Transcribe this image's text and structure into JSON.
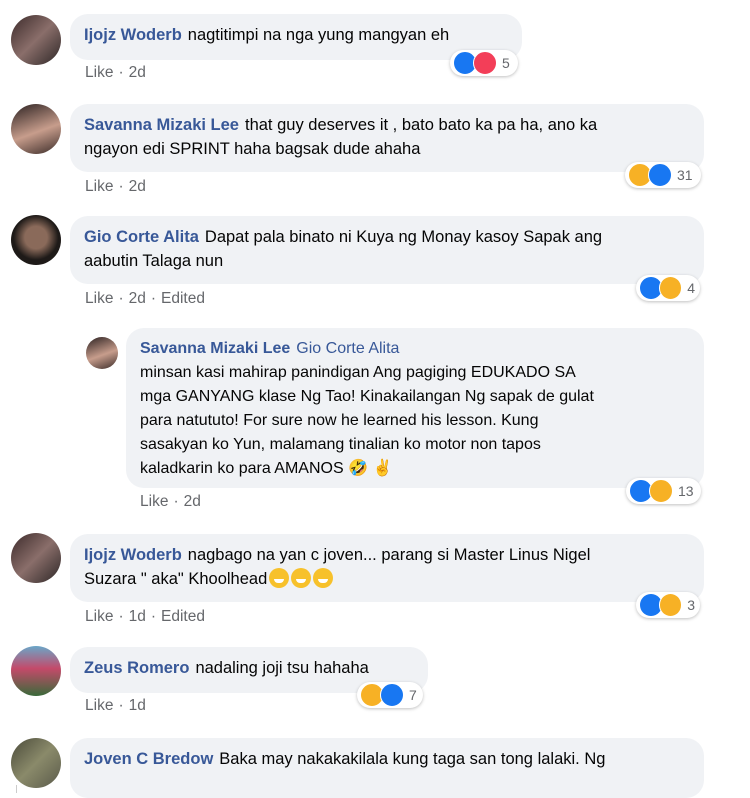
{
  "comments": [
    {
      "author": "Ijojz Woderb",
      "text": "nagtitimpi na nga yung mangyan eh",
      "like_label": "Like",
      "age": "2d",
      "edited": "",
      "reaction_count": "5"
    },
    {
      "author": "Savanna Mizaki Lee",
      "text_line1": "that guy deserves it , bato bato ka pa ha, ano ka",
      "text_line2": "ngayon edi SPRINT haha bagsak dude ahaha",
      "like_label": "Like",
      "age": "2d",
      "reaction_count": "31"
    },
    {
      "author": "Gio Corte Alita",
      "text_line1": "Dapat pala binato ni Kuya ng Monay kasoy Sapak ang",
      "text_line2": "aabutin Talaga nun",
      "like_label": "Like",
      "age": "2d",
      "edited": "Edited",
      "reaction_count": "4"
    },
    {
      "author": "Savanna Mizaki Lee",
      "tagged": "Gio Corte Alita",
      "lines": [
        "minsan kasi mahirap panindigan Ang pagiging EDUKADO SA",
        "mga GANYANG klase Ng Tao! Kinakailangan Ng sapak de gulat",
        "para natututo! For sure now he learned his lesson. Kung",
        "sasakyan ko Yun, malamang tinalian ko motor non tapos",
        "kaladkarin ko para AMANOS"
      ],
      "emoji_trail": "🤣 ✌",
      "like_label": "Like",
      "age": "2d",
      "reaction_count": "13"
    },
    {
      "author": "Ijojz Woderb",
      "text_line1": "nagbago na yan c joven... parang si Master Linus Nigel",
      "text_line2": "Suzara \" aka\" Khoolhead",
      "like_label": "Like",
      "age": "1d",
      "edited": "Edited",
      "reaction_count": "3"
    },
    {
      "author": "Zeus Romero",
      "text": "nadaling joji tsu hahaha",
      "like_label": "Like",
      "age": "1d",
      "reaction_count": "7"
    },
    {
      "author": "Joven C Bredow",
      "text": "Baka may nakakakilala kung taga san tong lalaki. Ng"
    }
  ],
  "colors": {
    "author": "#385898",
    "bubble": "#f0f2f5",
    "meta": "#65676b",
    "like_reaction": "#1877f2",
    "love_reaction": "#f33e58",
    "haha_reaction": "#f7b125"
  },
  "icons": [
    "like-reaction-icon",
    "love-reaction-icon",
    "haha-reaction-icon",
    "grin-emoji-icon",
    "rofl-emoji-icon",
    "victory-hand-emoji-icon"
  ]
}
